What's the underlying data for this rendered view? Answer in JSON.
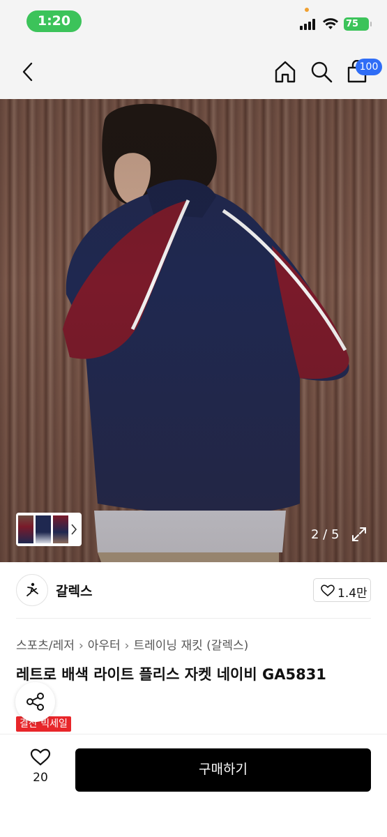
{
  "status_bar": {
    "time": "1:20",
    "battery": "75"
  },
  "nav": {
    "back_icon": "chevron-left-icon",
    "home_icon": "home-icon",
    "search_icon": "search-icon",
    "cart_icon": "shopping-bag-icon",
    "cart_badge": "100"
  },
  "gallery": {
    "counter": "2 / 5",
    "expand_icon": "expand-icon"
  },
  "brand": {
    "name": "갈렉스",
    "likes": "1.4만"
  },
  "breadcrumb": [
    "스포츠/레저",
    "아우터",
    "트레이닝 재킷 (갈렉스)"
  ],
  "product": {
    "title": "레트로 배색 라이트 플리스 자켓 네이비 GA5831",
    "sale_tag": "결산 빅세일"
  },
  "bottom_bar": {
    "wish_count": "20",
    "buy_label": "구매하기"
  },
  "colors": {
    "status_pill": "#3cc35a",
    "badge": "#2f6df6",
    "sale_tag": "#e8262a",
    "buy_button": "#000000",
    "jacket_navy": "#1f2850",
    "jacket_burgundy": "#7a1a2a"
  }
}
